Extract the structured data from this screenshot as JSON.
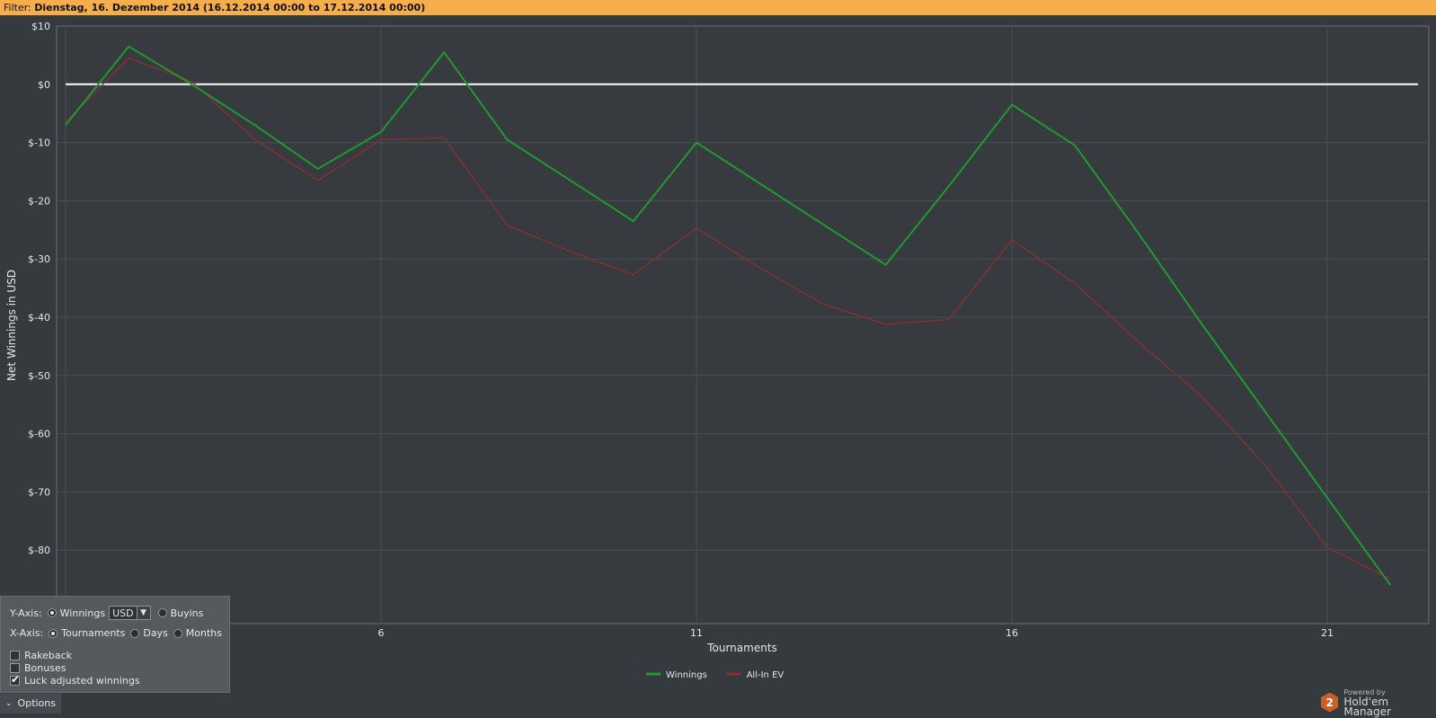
{
  "filter": {
    "label": "Filter:",
    "value": "Dienstag, 16. Dezember 2014 (16.12.2014 00:00 to 17.12.2014 00:00)"
  },
  "chart_data": {
    "type": "line",
    "xlabel": "Tournaments",
    "ylabel": "Net Winnings in USD",
    "xlim": [
      1,
      22.2
    ],
    "ylim": [
      -90,
      10
    ],
    "x_ticks": [
      6,
      11,
      16,
      21
    ],
    "y_ticks": [
      10,
      0,
      -10,
      -20,
      -30,
      -40,
      -50,
      -60,
      -70,
      -80
    ],
    "y_tick_labels": [
      "$10",
      "$0",
      "$-10",
      "$-20",
      "$-30",
      "$-40",
      "$-50",
      "$-60",
      "$-70",
      "$-80"
    ],
    "grid": true,
    "legend_position": "bottom-center",
    "zero_line": true,
    "series": [
      {
        "name": "Winnings",
        "color": "#1e9a2e",
        "x": [
          1,
          2,
          3,
          4,
          5,
          6,
          7,
          8,
          9,
          10,
          11,
          12,
          13,
          14,
          15,
          16,
          17,
          18,
          19,
          20,
          21,
          22
        ],
        "values": [
          -7,
          6.5,
          0,
          -7,
          -14.5,
          -8.2,
          5.5,
          -9.5,
          -16.5,
          -23.5,
          -10,
          -17,
          -24,
          -31,
          -17.5,
          -3.5,
          -10.5,
          -25.5,
          -41,
          -56,
          -71,
          -86
        ]
      },
      {
        "name": "All-In EV",
        "color": "#8c2f2f",
        "x": [
          1,
          2,
          3,
          4,
          5,
          6,
          7,
          8,
          9,
          10,
          11,
          12,
          13,
          14,
          15,
          16,
          17,
          18,
          19,
          20,
          21,
          22
        ],
        "values": [
          -6.5,
          4.5,
          0.5,
          -9.5,
          -16.5,
          -9.5,
          -9.2,
          -24.2,
          -28.7,
          -32.7,
          -24.7,
          -31.5,
          -37.7,
          -41.2,
          -40.4,
          -26.7,
          -34.2,
          -44.2,
          -53.5,
          -65.2,
          -79.5,
          -85
        ]
      }
    ]
  },
  "options": {
    "y_axis_label": "Y-Axis:",
    "winnings_label": "Winnings",
    "currency": "USD",
    "buyins_label": "Buyins",
    "x_axis_label": "X-Axis:",
    "tournaments_label": "Tournaments",
    "days_label": "Days",
    "months_label": "Months",
    "rakeback_label": "Rakeback",
    "bonuses_label": "Bonuses",
    "luck_label": "Luck adjusted winnings",
    "rakeback_checked": false,
    "bonuses_checked": false,
    "luck_checked": true,
    "tab_label": "Options"
  },
  "branding": {
    "powered_by": "Powered by",
    "product": "Hold'em Manager",
    "logo_glyph": "2",
    "logo_color": "#c8602a"
  }
}
